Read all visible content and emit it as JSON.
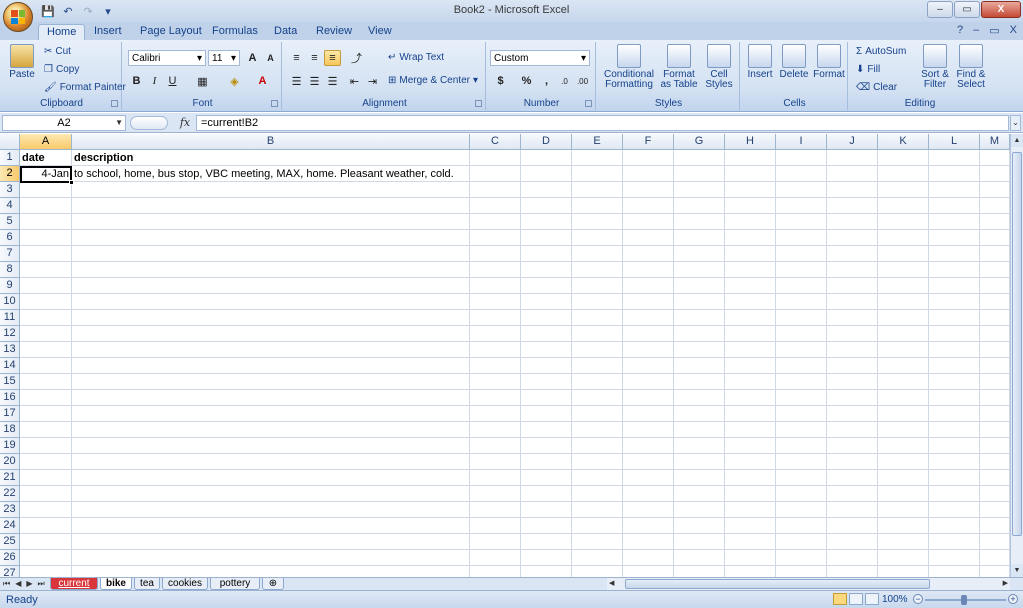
{
  "window": {
    "title": "Book2 - Microsoft Excel",
    "controls": {
      "minimize": "–",
      "maximize": "▭",
      "close": "X"
    }
  },
  "quick_access": {
    "save": "💾",
    "undo": "↶",
    "redo": "↷",
    "customize": "▾"
  },
  "ribbon_tabs": [
    {
      "label": "Home",
      "active": true
    },
    {
      "label": "Insert"
    },
    {
      "label": "Page Layout"
    },
    {
      "label": "Formulas"
    },
    {
      "label": "Data"
    },
    {
      "label": "Review"
    },
    {
      "label": "View"
    }
  ],
  "ribbon_right": {
    "help": "?",
    "min": "–",
    "restore": "▭",
    "close": "X"
  },
  "ribbon": {
    "clipboard": {
      "label": "Clipboard",
      "paste": "Paste",
      "cut": "Cut",
      "copy": "Copy",
      "format_painter": "Format Painter"
    },
    "font": {
      "label": "Font",
      "font_name": "Calibri",
      "font_size": "11",
      "grow": "A",
      "shrink": "A",
      "bold": "B",
      "italic": "I",
      "underline": "U"
    },
    "alignment": {
      "label": "Alignment",
      "wrap_text": "Wrap Text",
      "merge_center": "Merge & Center"
    },
    "number": {
      "label": "Number",
      "format": "Custom",
      "currency": "$",
      "percent": "%",
      "comma": ","
    },
    "styles": {
      "label": "Styles",
      "conditional": "Conditional",
      "conditional2": "Formatting",
      "format_table": "Format",
      "format_table2": "as Table",
      "cell_styles": "Cell",
      "cell_styles2": "Styles"
    },
    "cells": {
      "label": "Cells",
      "insert": "Insert",
      "delete": "Delete",
      "format": "Format"
    },
    "editing": {
      "label": "Editing",
      "autosum": "AutoSum",
      "fill": "Fill",
      "clear": "Clear",
      "sort": "Sort &",
      "sort2": "Filter",
      "find": "Find &",
      "find2": "Select"
    }
  },
  "formula_bar": {
    "name_box": "A2",
    "fx": "fx",
    "formula": "=current!B2"
  },
  "columns": [
    "A",
    "B",
    "C",
    "D",
    "E",
    "F",
    "G",
    "H",
    "I",
    "J",
    "K",
    "L",
    "M"
  ],
  "selected_column": "A",
  "selected_row": "2",
  "rows": [
    "1",
    "2",
    "3",
    "4",
    "5",
    "6",
    "7",
    "8",
    "9",
    "10",
    "11",
    "12",
    "13",
    "14",
    "15",
    "16",
    "17",
    "18",
    "19",
    "20",
    "21",
    "22",
    "23",
    "24",
    "25",
    "26",
    "27"
  ],
  "cells": {
    "A1": "date",
    "B1": "description",
    "A2": "4-Jan",
    "B2": "to school, home, bus stop, VBC meeting, MAX, home. Pleasant weather, cold."
  },
  "sheet_tabs": [
    {
      "label": "current",
      "style": "red"
    },
    {
      "label": "bike",
      "style": "active"
    },
    {
      "label": "tea"
    },
    {
      "label": "cookies"
    },
    {
      "label": "pottery"
    }
  ],
  "sheet_nav": [
    "⏮",
    "◀",
    "▶",
    "⏭"
  ],
  "status": {
    "text": "Ready",
    "zoom": "100%",
    "minus": "−",
    "plus": "+"
  },
  "colors": {
    "accent": "#15428b",
    "selection": "#f8c96a",
    "red_tab": "#d9363b"
  }
}
